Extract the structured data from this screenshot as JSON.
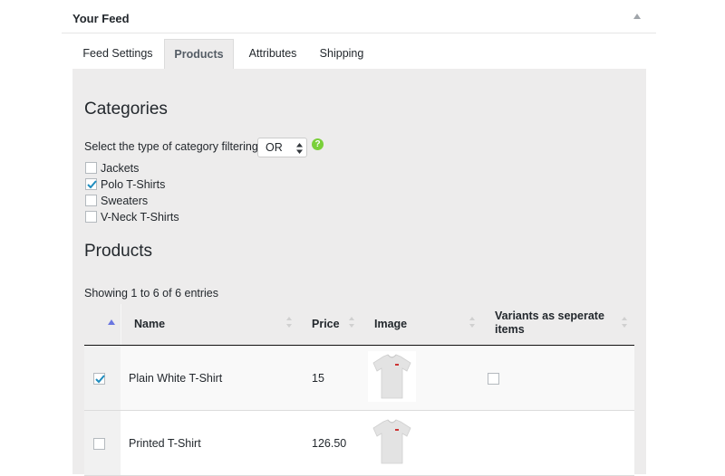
{
  "panel": {
    "title": "Your Feed"
  },
  "tabs": [
    {
      "label": "Feed Settings",
      "active": false
    },
    {
      "label": "Products",
      "active": true
    },
    {
      "label": "Attributes",
      "active": false
    },
    {
      "label": "Shipping",
      "active": false
    }
  ],
  "categories": {
    "heading": "Categories",
    "filter_label": "Select the type of category filtering",
    "filter_value": "OR",
    "items": [
      {
        "label": "Jackets",
        "checked": false
      },
      {
        "label": "Polo T-Shirts",
        "checked": true
      },
      {
        "label": "Sweaters",
        "checked": false
      },
      {
        "label": "V-Neck T-Shirts",
        "checked": false
      }
    ]
  },
  "products": {
    "heading": "Products",
    "showing": "Showing 1 to 6 of 6 entries",
    "columns": {
      "name": "Name",
      "price": "Price",
      "image": "Image",
      "variants": "Variants as seperate items"
    },
    "rows": [
      {
        "selected": true,
        "name": "Plain White T-Shirt",
        "price": "15",
        "variants_checked": false
      },
      {
        "selected": false,
        "name": "Printed T-Shirt",
        "price": "126.50",
        "variants_checked": null
      }
    ]
  },
  "colors": {
    "accent": "#0073aa",
    "help": "#7ad03a",
    "sort_active": "#6a76e0"
  },
  "icons": [
    "collapse-up-icon",
    "help-icon",
    "checkmark-icon",
    "sort-icon",
    "tshirt-icon"
  ]
}
